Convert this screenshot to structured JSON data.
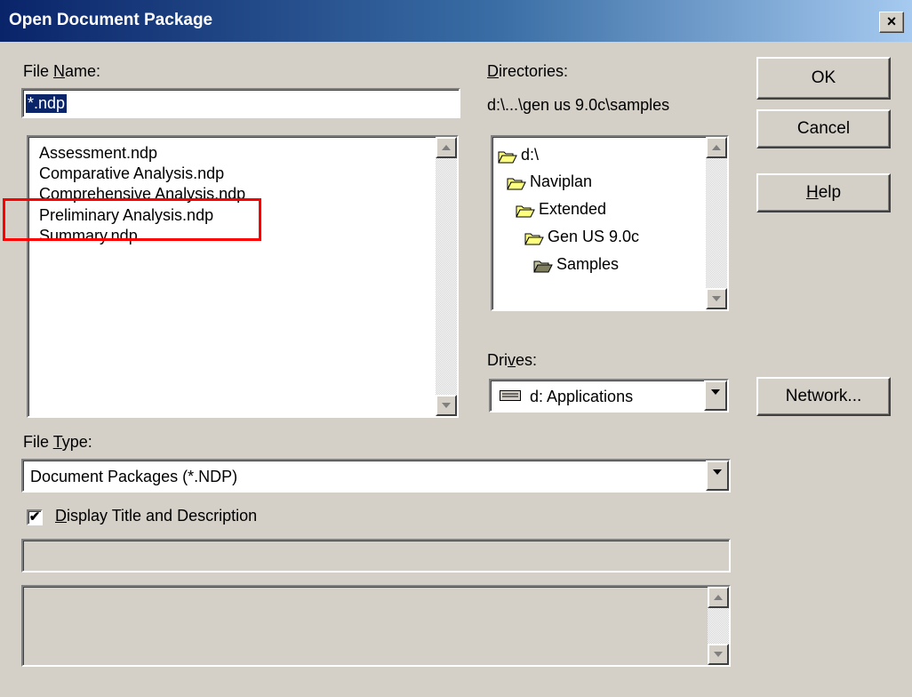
{
  "window": {
    "title": "Open Document Package",
    "close_glyph": "×"
  },
  "file_name": {
    "label_pre": "File ",
    "label_accel": "N",
    "label_post": "ame:",
    "value": "*.ndp",
    "files": [
      "Assessment.ndp",
      "Comparative Analysis.ndp",
      "Comprehensive Analysis.ndp",
      "Preliminary Analysis.ndp",
      "Summary.ndp"
    ],
    "highlighted_file": "Preliminary Analysis.ndp",
    "highlight_color": "#ff0000"
  },
  "directories": {
    "label_accel": "D",
    "label_post": "irectories:",
    "current_path": "d:\\...\\gen us 9.0c\\samples",
    "tree": [
      {
        "label": "d:\\",
        "icon": "open-folder-icon"
      },
      {
        "label": "Naviplan",
        "icon": "open-folder-icon"
      },
      {
        "label": "Extended",
        "icon": "open-folder-icon"
      },
      {
        "label": "Gen US 9.0c",
        "icon": "open-folder-icon"
      },
      {
        "label": "Samples",
        "icon": "open-folder-shaded-icon"
      }
    ]
  },
  "drives": {
    "label_pre": "Dri",
    "label_accel": "v",
    "label_post": "es:",
    "selected": "d: Applications",
    "icon": "drive-icon"
  },
  "file_type": {
    "label_pre": "File ",
    "label_accel": "T",
    "label_post": "ype:",
    "selected": "Document Packages (*.NDP)"
  },
  "display_title": {
    "accel": "D",
    "label_post": "isplay Title and Description",
    "checked": true,
    "check_glyph": "✔"
  },
  "buttons": {
    "ok": "OK",
    "cancel": "Cancel",
    "help_accel": "H",
    "help_post": "elp",
    "network": "Network..."
  },
  "colors": {
    "title_bar_start": "#0a246a",
    "title_bar_end": "#a6caf0",
    "dialog_bg": "#d4d0c8",
    "selection_bg": "#0a246a",
    "folder_yellow": "#ffff80"
  }
}
